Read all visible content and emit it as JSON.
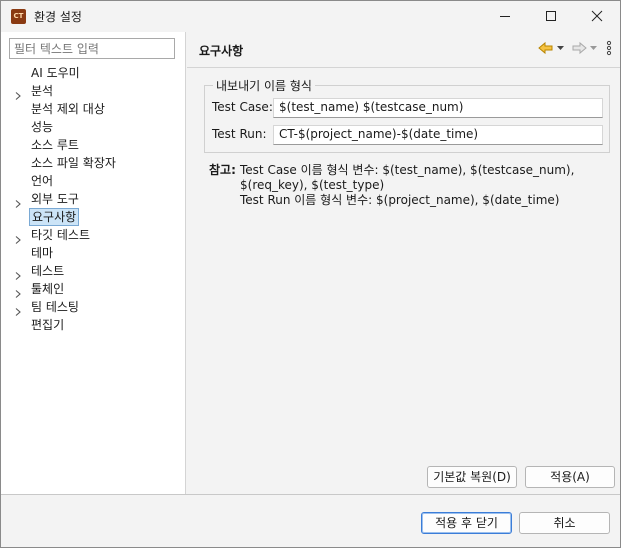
{
  "window": {
    "title": "환경 설정",
    "app_icon_text": "CT"
  },
  "filter": {
    "placeholder": "필터 텍스트 입력"
  },
  "tree": [
    {
      "label": "AI 도우미",
      "expandable": false,
      "selected": false
    },
    {
      "label": "분석",
      "expandable": true,
      "selected": false
    },
    {
      "label": "분석 제외 대상",
      "expandable": false,
      "selected": false
    },
    {
      "label": "성능",
      "expandable": false,
      "selected": false
    },
    {
      "label": "소스 루트",
      "expandable": false,
      "selected": false
    },
    {
      "label": "소스 파일 확장자",
      "expandable": false,
      "selected": false
    },
    {
      "label": "언어",
      "expandable": false,
      "selected": false
    },
    {
      "label": "외부 도구",
      "expandable": true,
      "selected": false
    },
    {
      "label": "요구사항",
      "expandable": false,
      "selected": true
    },
    {
      "label": "타깃 테스트",
      "expandable": true,
      "selected": false
    },
    {
      "label": "테마",
      "expandable": false,
      "selected": false
    },
    {
      "label": "테스트",
      "expandable": true,
      "selected": false
    },
    {
      "label": "툴체인",
      "expandable": true,
      "selected": false
    },
    {
      "label": "팀 테스팅",
      "expandable": true,
      "selected": false
    },
    {
      "label": "편집기",
      "expandable": false,
      "selected": false
    }
  ],
  "page": {
    "title": "요구사항",
    "group_title": "내보내기 이름 형식",
    "fields": {
      "test_case_label": "Test Case:",
      "test_case_value": "$(test_name) $(testcase_num)",
      "test_run_label": "Test Run:",
      "test_run_value": "CT-$(project_name)-$(date_time)"
    },
    "note": {
      "label": "참고:",
      "lines": [
        "Test Case 이름 형식 변수: $(test_name), $(testcase_num),",
        "$(req_key), $(test_type)",
        "Test Run 이름 형식 변수: $(project_name), $(date_time)"
      ]
    }
  },
  "buttons": {
    "restore_defaults": "기본값 복원(D)",
    "apply": "적용(A)",
    "apply_and_close": "적용 후 닫기",
    "cancel": "취소"
  },
  "colors": {
    "accent": "#3b7dd8",
    "selection_bg": "#cce4f7",
    "back_arrow": "#e0a400"
  },
  "icons": {
    "back": "arrow-left-icon",
    "forward": "arrow-right-icon",
    "menu": "vertical-ellipsis-icon"
  }
}
